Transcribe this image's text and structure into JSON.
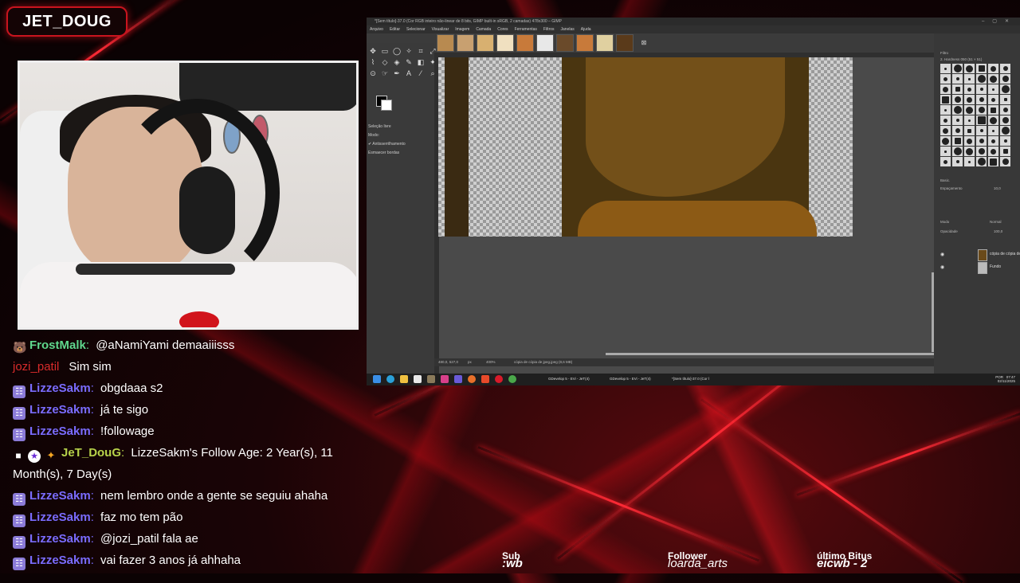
{
  "channel_name": "JET_DOUG",
  "chat": [
    {
      "badges": [
        "bear"
      ],
      "user": "FrostMalk",
      "user_class": "u-frost",
      "text": "@aNamiYami demaaiiisss"
    },
    {
      "badges": [],
      "user": "jozi_patil",
      "user_class": "u-jozi",
      "text": "Sim sim"
    },
    {
      "badges": [
        "sub"
      ],
      "user": "LizzeSakm",
      "user_class": "u-lizze",
      "text": "obgdaaa s2"
    },
    {
      "badges": [
        "sub"
      ],
      "user": "LizzeSakm",
      "user_class": "u-lizze",
      "text": "já te sigo"
    },
    {
      "badges": [
        "sub"
      ],
      "user": "LizzeSakm",
      "user_class": "u-lizze",
      "text": "!followage"
    },
    {
      "badges": [
        "cam",
        "star",
        "fire"
      ],
      "user": "JeT_DouG",
      "user_class": "u-jet",
      "text": "LizzeSakm's Follow Age: 2 Year(s), 11 Month(s), 7 Day(s)"
    },
    {
      "badges": [
        "sub"
      ],
      "user": "LizzeSakm",
      "user_class": "u-lizze",
      "text": "nem lembro onde a gente se seguiu ahaha"
    },
    {
      "badges": [
        "sub"
      ],
      "user": "LizzeSakm",
      "user_class": "u-lizze",
      "text": "faz mo tem pão"
    },
    {
      "badges": [
        "sub"
      ],
      "user": "LizzeSakm",
      "user_class": "u-lizze",
      "text": "@jozi_patil fala ae"
    },
    {
      "badges": [
        "sub"
      ],
      "user": "LizzeSakm",
      "user_class": "u-lizze",
      "text": "vai fazer 3 anos já ahhaha"
    }
  ],
  "bottom_bar": {
    "sub_label": "Sub",
    "sub_value": ":wb",
    "follower_label": "Follower",
    "follower_value": "loarda_arts",
    "bits_label": "último Bitus",
    "bits_value": "eicwb - 2"
  },
  "gimp": {
    "title": "*[Sem título]-37.0 (Cor RGB inteiro não-linear de 8 bits, GIMP built-in sRGB, 2 camadas) 478x300 – GIMP",
    "menu": [
      "Arquivo",
      "Editar",
      "Selecionar",
      "Visualizar",
      "Imagem",
      "Camada",
      "Cores",
      "Ferramentas",
      "Filtros",
      "Janelas",
      "Ajuda"
    ],
    "tool_options": [
      "Seleção livre",
      "Modo:",
      "✔ Antisserrilhamento",
      "Esmaecer bordas"
    ],
    "status": {
      "coords": "480,0, 527,0",
      "unit": "px",
      "zoom": "400%",
      "file": "cópia de cópia de jpeg.jpeg (8,6 MB)"
    },
    "right_panel": {
      "filter": "Filtro",
      "brush_name": "2. Hardness 050 (51 × 51)",
      "preset": "Basic.",
      "spacing_label": "Espaçamento",
      "spacing_value": "10,0",
      "mode_label": "Modo",
      "mode_value": "Normal",
      "opacity_label": "Opacidade",
      "opacity_value": "100,0"
    },
    "layers": [
      {
        "name": "cópia de cópia de"
      },
      {
        "name": "Fundo"
      }
    ],
    "taskbar": {
      "app1": "GDevelop 5 - EVi - JeT(4)",
      "app2": "GDevelop 5 - EVi - JeT(4)",
      "app3": "*[Sem título]-37.0 (Cor l",
      "lang": "POR",
      "time": "07:47",
      "date": "02/11/2025"
    }
  }
}
